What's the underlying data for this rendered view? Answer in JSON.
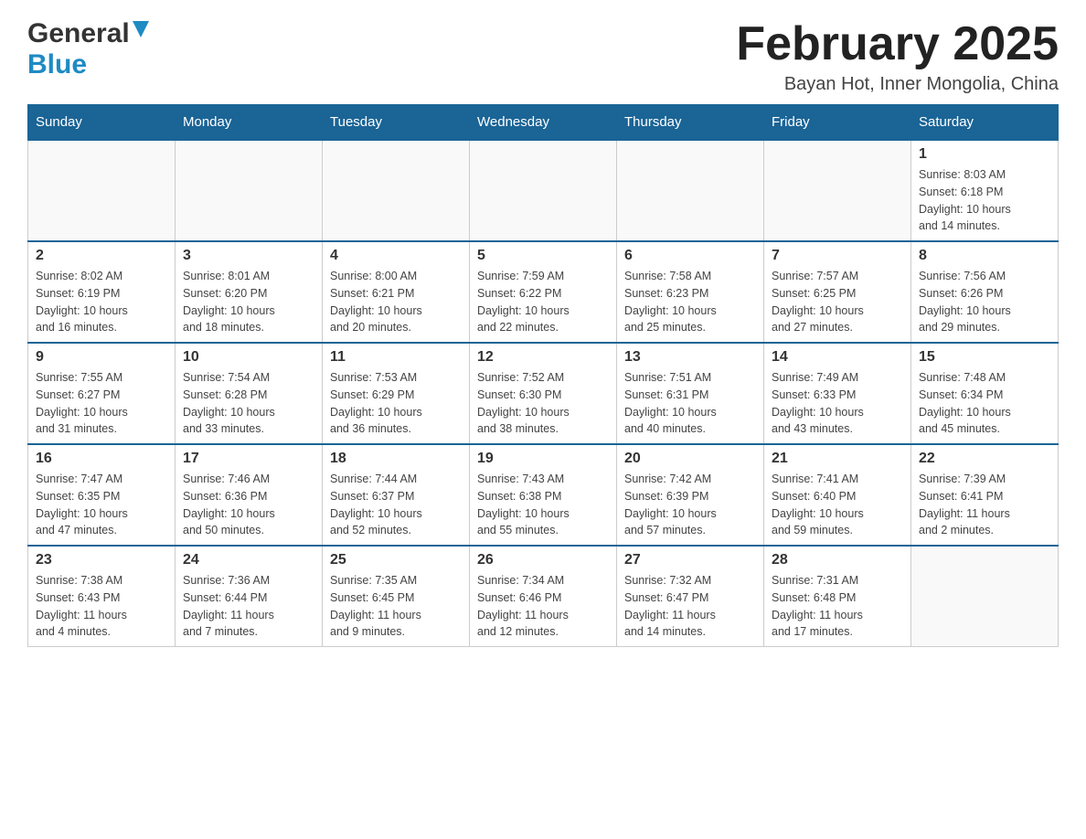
{
  "header": {
    "logo": {
      "general": "General",
      "blue": "Blue",
      "arrow_title": "GeneralBlue logo"
    },
    "title": "February 2025",
    "subtitle": "Bayan Hot, Inner Mongolia, China"
  },
  "calendar": {
    "days_of_week": [
      "Sunday",
      "Monday",
      "Tuesday",
      "Wednesday",
      "Thursday",
      "Friday",
      "Saturday"
    ],
    "weeks": [
      {
        "days": [
          {
            "number": "",
            "info": ""
          },
          {
            "number": "",
            "info": ""
          },
          {
            "number": "",
            "info": ""
          },
          {
            "number": "",
            "info": ""
          },
          {
            "number": "",
            "info": ""
          },
          {
            "number": "",
            "info": ""
          },
          {
            "number": "1",
            "info": "Sunrise: 8:03 AM\nSunset: 6:18 PM\nDaylight: 10 hours\nand 14 minutes."
          }
        ]
      },
      {
        "days": [
          {
            "number": "2",
            "info": "Sunrise: 8:02 AM\nSunset: 6:19 PM\nDaylight: 10 hours\nand 16 minutes."
          },
          {
            "number": "3",
            "info": "Sunrise: 8:01 AM\nSunset: 6:20 PM\nDaylight: 10 hours\nand 18 minutes."
          },
          {
            "number": "4",
            "info": "Sunrise: 8:00 AM\nSunset: 6:21 PM\nDaylight: 10 hours\nand 20 minutes."
          },
          {
            "number": "5",
            "info": "Sunrise: 7:59 AM\nSunset: 6:22 PM\nDaylight: 10 hours\nand 22 minutes."
          },
          {
            "number": "6",
            "info": "Sunrise: 7:58 AM\nSunset: 6:23 PM\nDaylight: 10 hours\nand 25 minutes."
          },
          {
            "number": "7",
            "info": "Sunrise: 7:57 AM\nSunset: 6:25 PM\nDaylight: 10 hours\nand 27 minutes."
          },
          {
            "number": "8",
            "info": "Sunrise: 7:56 AM\nSunset: 6:26 PM\nDaylight: 10 hours\nand 29 minutes."
          }
        ]
      },
      {
        "days": [
          {
            "number": "9",
            "info": "Sunrise: 7:55 AM\nSunset: 6:27 PM\nDaylight: 10 hours\nand 31 minutes."
          },
          {
            "number": "10",
            "info": "Sunrise: 7:54 AM\nSunset: 6:28 PM\nDaylight: 10 hours\nand 33 minutes."
          },
          {
            "number": "11",
            "info": "Sunrise: 7:53 AM\nSunset: 6:29 PM\nDaylight: 10 hours\nand 36 minutes."
          },
          {
            "number": "12",
            "info": "Sunrise: 7:52 AM\nSunset: 6:30 PM\nDaylight: 10 hours\nand 38 minutes."
          },
          {
            "number": "13",
            "info": "Sunrise: 7:51 AM\nSunset: 6:31 PM\nDaylight: 10 hours\nand 40 minutes."
          },
          {
            "number": "14",
            "info": "Sunrise: 7:49 AM\nSunset: 6:33 PM\nDaylight: 10 hours\nand 43 minutes."
          },
          {
            "number": "15",
            "info": "Sunrise: 7:48 AM\nSunset: 6:34 PM\nDaylight: 10 hours\nand 45 minutes."
          }
        ]
      },
      {
        "days": [
          {
            "number": "16",
            "info": "Sunrise: 7:47 AM\nSunset: 6:35 PM\nDaylight: 10 hours\nand 47 minutes."
          },
          {
            "number": "17",
            "info": "Sunrise: 7:46 AM\nSunset: 6:36 PM\nDaylight: 10 hours\nand 50 minutes."
          },
          {
            "number": "18",
            "info": "Sunrise: 7:44 AM\nSunset: 6:37 PM\nDaylight: 10 hours\nand 52 minutes."
          },
          {
            "number": "19",
            "info": "Sunrise: 7:43 AM\nSunset: 6:38 PM\nDaylight: 10 hours\nand 55 minutes."
          },
          {
            "number": "20",
            "info": "Sunrise: 7:42 AM\nSunset: 6:39 PM\nDaylight: 10 hours\nand 57 minutes."
          },
          {
            "number": "21",
            "info": "Sunrise: 7:41 AM\nSunset: 6:40 PM\nDaylight: 10 hours\nand 59 minutes."
          },
          {
            "number": "22",
            "info": "Sunrise: 7:39 AM\nSunset: 6:41 PM\nDaylight: 11 hours\nand 2 minutes."
          }
        ]
      },
      {
        "days": [
          {
            "number": "23",
            "info": "Sunrise: 7:38 AM\nSunset: 6:43 PM\nDaylight: 11 hours\nand 4 minutes."
          },
          {
            "number": "24",
            "info": "Sunrise: 7:36 AM\nSunset: 6:44 PM\nDaylight: 11 hours\nand 7 minutes."
          },
          {
            "number": "25",
            "info": "Sunrise: 7:35 AM\nSunset: 6:45 PM\nDaylight: 11 hours\nand 9 minutes."
          },
          {
            "number": "26",
            "info": "Sunrise: 7:34 AM\nSunset: 6:46 PM\nDaylight: 11 hours\nand 12 minutes."
          },
          {
            "number": "27",
            "info": "Sunrise: 7:32 AM\nSunset: 6:47 PM\nDaylight: 11 hours\nand 14 minutes."
          },
          {
            "number": "28",
            "info": "Sunrise: 7:31 AM\nSunset: 6:48 PM\nDaylight: 11 hours\nand 17 minutes."
          },
          {
            "number": "",
            "info": ""
          }
        ]
      }
    ]
  }
}
